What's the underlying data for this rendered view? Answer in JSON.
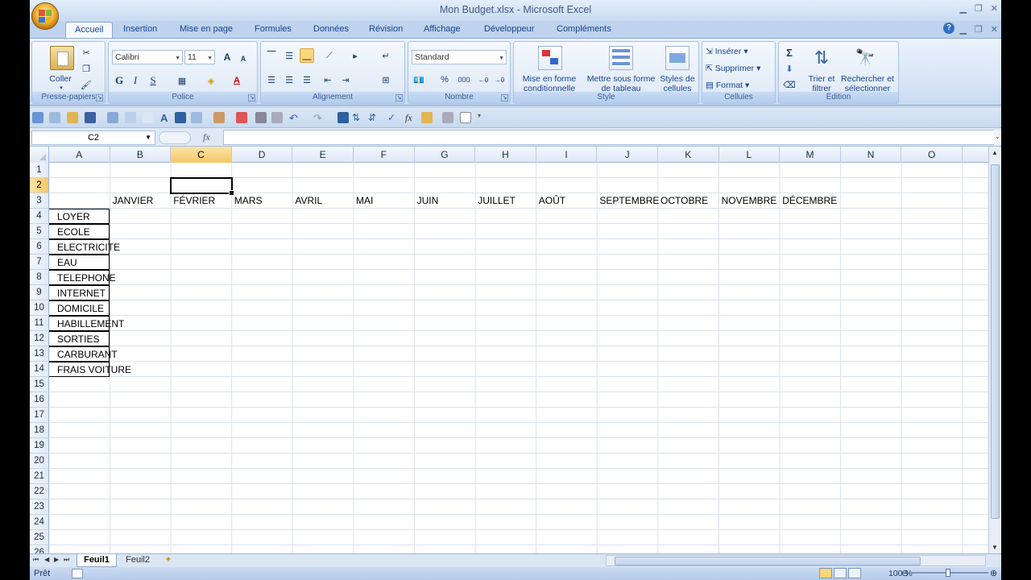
{
  "window": {
    "file_name": "Mon Budget.xlsx",
    "separator": " - ",
    "app_name": "Microsoft Excel"
  },
  "tabs": [
    "Accueil",
    "Insertion",
    "Mise en page",
    "Formules",
    "Données",
    "Révision",
    "Affichage",
    "Développeur",
    "Compléments"
  ],
  "ribbon": {
    "clipboard": {
      "paste": "Coller",
      "label": "Presse-papiers"
    },
    "font": {
      "name": "Calibri",
      "size": "11",
      "bold": "G",
      "italic": "I",
      "underline": "S",
      "grow": "A",
      "shrink": "A",
      "label": "Police"
    },
    "alignment": {
      "label": "Alignement"
    },
    "number": {
      "format": "Standard",
      "percent": "%",
      "thousands": "000",
      "label": "Nombre"
    },
    "style": {
      "conditional": "Mise en forme conditionnelle",
      "table": "Mettre sous forme de tableau",
      "cell_styles": "Styles de cellules",
      "label": "Style"
    },
    "cells": {
      "insert": "Insérer",
      "delete": "Supprimer",
      "format": "Format",
      "label": "Cellules"
    },
    "editing": {
      "sigma": "Σ",
      "sort": "Trier et filtrer",
      "find": "Rechercher et sélectionner",
      "label": "Édition"
    }
  },
  "formula_bar": {
    "name_box": "C2",
    "fx": "fx",
    "value": ""
  },
  "columns": [
    "A",
    "B",
    "C",
    "D",
    "E",
    "F",
    "G",
    "H",
    "I",
    "J",
    "K",
    "L",
    "M",
    "N",
    "O"
  ],
  "selected_column": "C",
  "selected_row": "2",
  "rows": [
    "1",
    "2",
    "3",
    "4",
    "5",
    "6",
    "7",
    "8",
    "9",
    "10",
    "11",
    "12",
    "13",
    "14",
    "15",
    "16",
    "17",
    "18",
    "19",
    "20",
    "21",
    "22",
    "23",
    "24",
    "25",
    "26"
  ],
  "months": [
    "JANVIER",
    "FÉVRIER",
    "MARS",
    "AVRIL",
    "MAI",
    "JUIN",
    "JUILLET",
    "AOÛT",
    "SEPTEMBRE",
    "OCTOBRE",
    "NOVEMBRE",
    "DÉCEMBRE"
  ],
  "categories": [
    "LOYER",
    "ECOLE",
    "ELECTRICITE",
    "EAU",
    "TELEPHONE",
    "INTERNET",
    "DOMICILE",
    "HABILLEMENT",
    "SORTIES",
    "CARBURANT",
    "FRAIS VOITURE"
  ],
  "sheets": [
    "Feuil1",
    "Feuil2"
  ],
  "active_sheet": "Feuil1",
  "status": {
    "text": "Prêt",
    "zoom": "100 %"
  },
  "colors": {
    "ribbon": "#dae6f5",
    "selection": "#f5c766",
    "grid": "#dae2ec"
  }
}
